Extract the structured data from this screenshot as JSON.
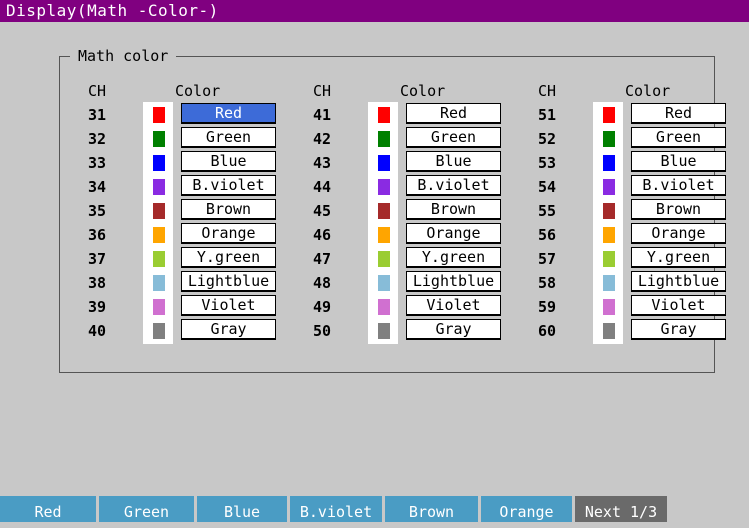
{
  "title": "Display(Math -Color-)",
  "group_title": "Math color",
  "headers": {
    "ch": "CH",
    "color": "Color"
  },
  "columns": [
    {
      "rows": [
        {
          "ch": "31",
          "color": "Red",
          "swatch": "#ff0000",
          "selected": true
        },
        {
          "ch": "32",
          "color": "Green",
          "swatch": "#008000"
        },
        {
          "ch": "33",
          "color": "Blue",
          "swatch": "#0000ff"
        },
        {
          "ch": "34",
          "color": "B.violet",
          "swatch": "#8a2be2"
        },
        {
          "ch": "35",
          "color": "Brown",
          "swatch": "#a52a2a"
        },
        {
          "ch": "36",
          "color": "Orange",
          "swatch": "#ffa500"
        },
        {
          "ch": "37",
          "color": "Y.green",
          "swatch": "#9acd32"
        },
        {
          "ch": "38",
          "color": "Lightblue",
          "swatch": "#87bcd8"
        },
        {
          "ch": "39",
          "color": "Violet",
          "swatch": "#d070d0"
        },
        {
          "ch": "40",
          "color": "Gray",
          "swatch": "#808080"
        }
      ]
    },
    {
      "rows": [
        {
          "ch": "41",
          "color": "Red",
          "swatch": "#ff0000"
        },
        {
          "ch": "42",
          "color": "Green",
          "swatch": "#008000"
        },
        {
          "ch": "43",
          "color": "Blue",
          "swatch": "#0000ff"
        },
        {
          "ch": "44",
          "color": "B.violet",
          "swatch": "#8a2be2"
        },
        {
          "ch": "45",
          "color": "Brown",
          "swatch": "#a52a2a"
        },
        {
          "ch": "46",
          "color": "Orange",
          "swatch": "#ffa500"
        },
        {
          "ch": "47",
          "color": "Y.green",
          "swatch": "#9acd32"
        },
        {
          "ch": "48",
          "color": "Lightblue",
          "swatch": "#87bcd8"
        },
        {
          "ch": "49",
          "color": "Violet",
          "swatch": "#d070d0"
        },
        {
          "ch": "50",
          "color": "Gray",
          "swatch": "#808080"
        }
      ]
    },
    {
      "rows": [
        {
          "ch": "51",
          "color": "Red",
          "swatch": "#ff0000"
        },
        {
          "ch": "52",
          "color": "Green",
          "swatch": "#008000"
        },
        {
          "ch": "53",
          "color": "Blue",
          "swatch": "#0000ff"
        },
        {
          "ch": "54",
          "color": "B.violet",
          "swatch": "#8a2be2"
        },
        {
          "ch": "55",
          "color": "Brown",
          "swatch": "#a52a2a"
        },
        {
          "ch": "56",
          "color": "Orange",
          "swatch": "#ffa500"
        },
        {
          "ch": "57",
          "color": "Y.green",
          "swatch": "#9acd32"
        },
        {
          "ch": "58",
          "color": "Lightblue",
          "swatch": "#87bcd8"
        },
        {
          "ch": "59",
          "color": "Violet",
          "swatch": "#d070d0"
        },
        {
          "ch": "60",
          "color": "Gray",
          "swatch": "#808080"
        }
      ]
    }
  ],
  "softkeys": [
    "Red",
    "Green",
    "Blue",
    "B.violet",
    "Brown",
    "Orange",
    "Next 1/3"
  ],
  "colors": {
    "titlebar": "#800080",
    "background": "#c8c8c8",
    "selected": "#3d6bd8",
    "softkey": "#4a9cc4",
    "softkey_next": "#6a6a6a"
  }
}
